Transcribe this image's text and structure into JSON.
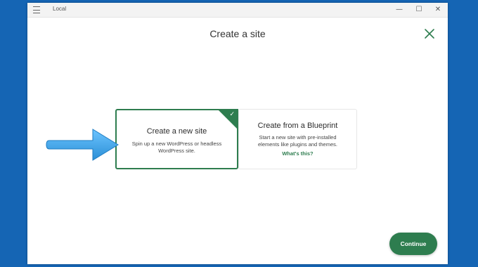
{
  "window": {
    "app_name": "Local",
    "controls": {
      "minimize": "—",
      "maximize": "☐",
      "close": "✕"
    }
  },
  "page": {
    "title": "Create a site"
  },
  "options": [
    {
      "title": "Create a new site",
      "description": "Spin up a new WordPress or headless WordPress site.",
      "selected": true
    },
    {
      "title": "Create from a Blueprint",
      "description": "Start a new site with pre-installed elements like plugins and themes.",
      "link": "What's this?",
      "selected": false
    }
  ],
  "actions": {
    "continue_label": "Continue"
  },
  "colors": {
    "accent": "#2e7d4f",
    "desktop": "#1565b4",
    "pointer_arrow": "#3aa0e6"
  }
}
